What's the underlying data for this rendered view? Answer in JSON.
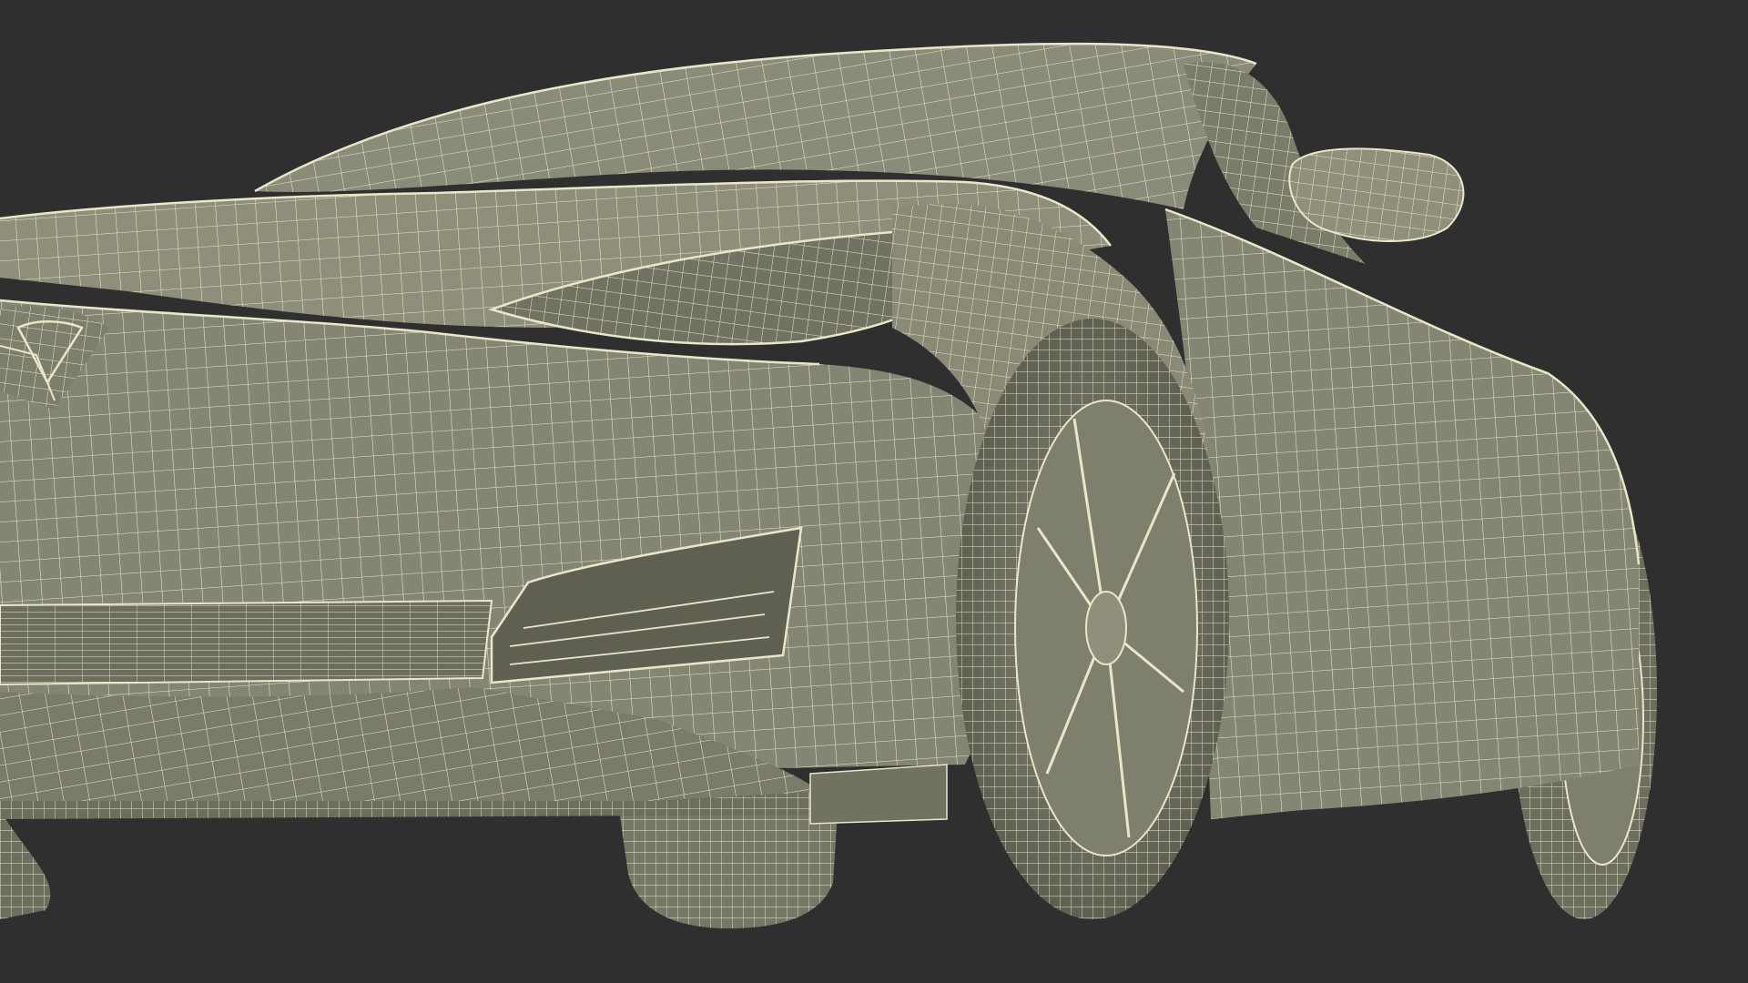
{
  "scene": {
    "subject": "car-front-wireframe",
    "render_style": "shaded wireframe"
  },
  "colors": {
    "background": "#2f2f30",
    "shade": "#858574",
    "shade_light": "#96967f",
    "shade_dark": "#676757",
    "shadow": "#55564a",
    "wire": "#e9e7c9",
    "wire_soft": "#d6d4b3"
  }
}
